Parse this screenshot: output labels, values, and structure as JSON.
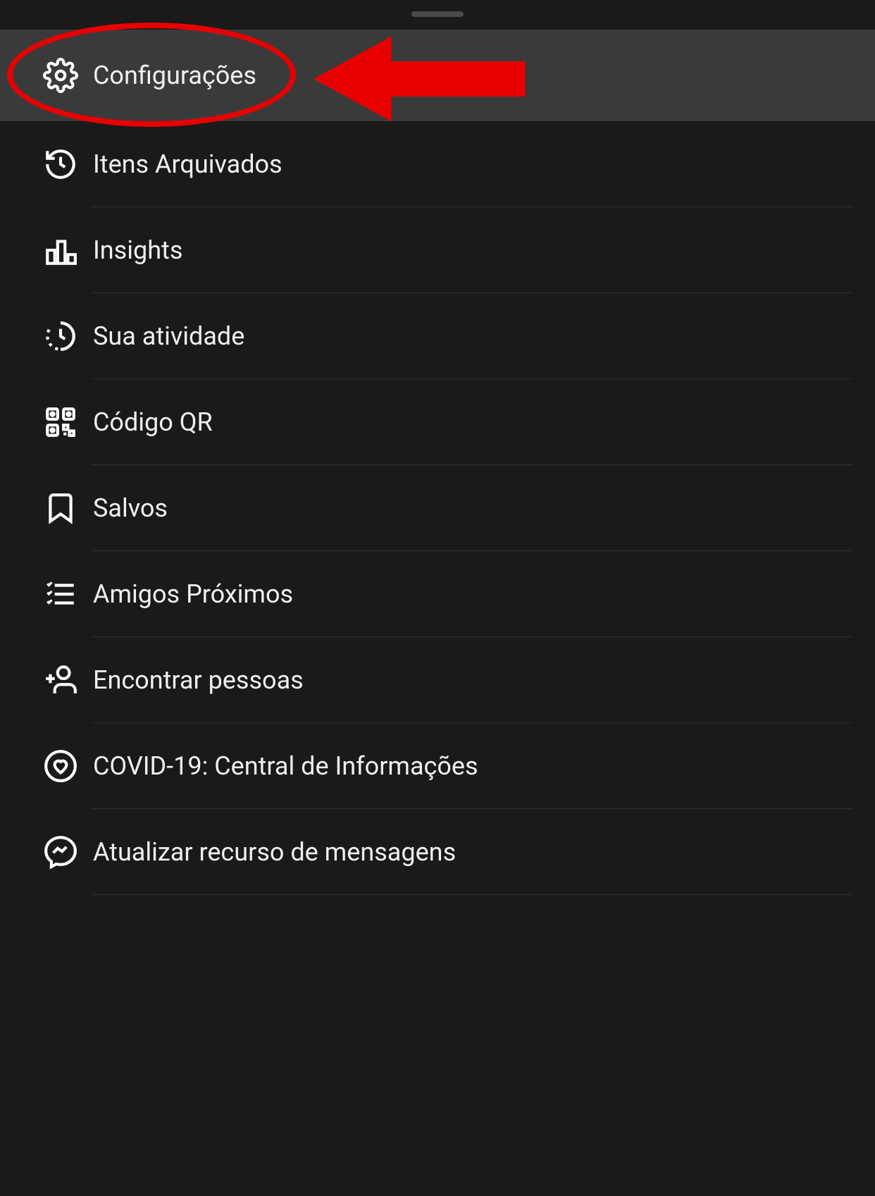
{
  "menu": {
    "items": [
      {
        "id": "settings",
        "label": "Configurações",
        "icon": "gear-icon",
        "highlighted": true
      },
      {
        "id": "archive",
        "label": "Itens Arquivados",
        "icon": "history-icon",
        "highlighted": false
      },
      {
        "id": "insights",
        "label": "Insights",
        "icon": "bar-chart-icon",
        "highlighted": false
      },
      {
        "id": "activity",
        "label": "Sua atividade",
        "icon": "activity-clock-icon",
        "highlighted": false
      },
      {
        "id": "qrcode",
        "label": "Código QR",
        "icon": "qr-code-icon",
        "highlighted": false
      },
      {
        "id": "saved",
        "label": "Salvos",
        "icon": "bookmark-icon",
        "highlighted": false
      },
      {
        "id": "close-friends",
        "label": "Amigos Próximos",
        "icon": "close-friends-icon",
        "highlighted": false
      },
      {
        "id": "discover",
        "label": "Encontrar pessoas",
        "icon": "discover-people-icon",
        "highlighted": false
      },
      {
        "id": "covid",
        "label": "COVID-19: Central de Informações",
        "icon": "heart-circle-icon",
        "highlighted": false
      },
      {
        "id": "messenger",
        "label": "Atualizar recurso de mensagens",
        "icon": "messenger-icon",
        "highlighted": false
      }
    ]
  },
  "annotation": {
    "circle_color": "#e80000",
    "arrow_color": "#e80000"
  }
}
